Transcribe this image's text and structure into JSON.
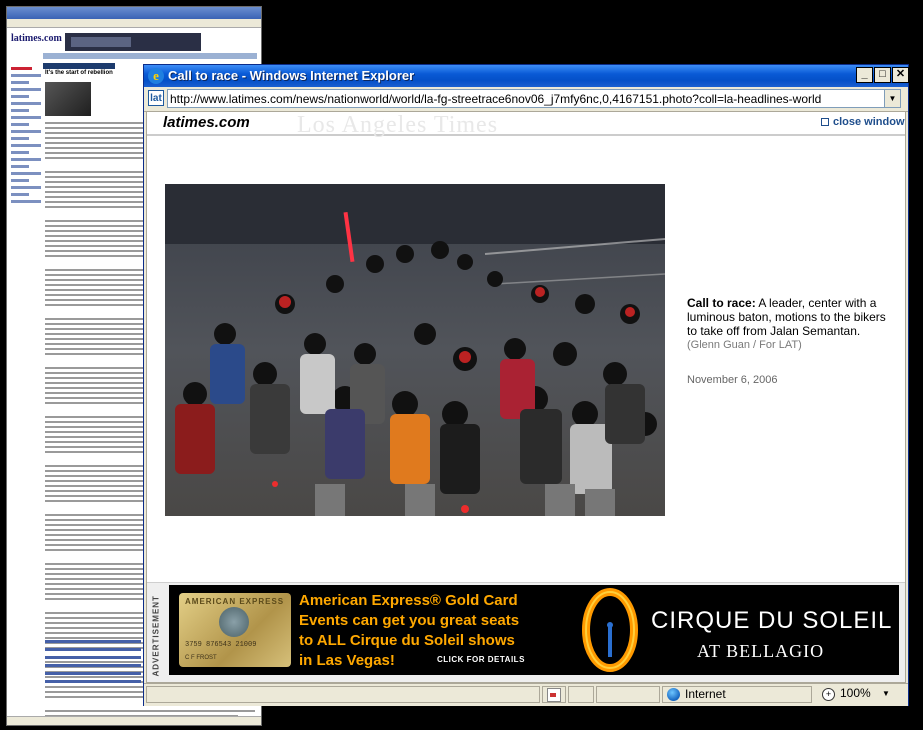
{
  "background_window": {
    "logo": "latimes.com",
    "headline": "It's the start of rebellion"
  },
  "ie": {
    "title": "Call to race - Windows Internet Explorer",
    "title_icon_glyph": "e",
    "url": "http://www.latimes.com/news/nationworld/world/la-fg-streetrace6nov06_j7mfy6nc,0,4167151.photo?coll=la-headlines-world",
    "min_glyph": "_",
    "max_glyph": "□",
    "close_glyph": "✕",
    "dropdown_glyph": "▼",
    "addr_icon_glyph": "lat"
  },
  "page": {
    "logo": "latimes.com",
    "masthead": "Los Angeles Times",
    "close_window": "close window",
    "caption_lead": "Call to race:",
    "caption_body": " A leader, center with a luminous baton, motions to the bikers to take off from Jalan Semantan.",
    "photo_credit": "(Glenn Guan / For LAT)",
    "date": "November 6, 2006"
  },
  "ad": {
    "vertical_label": "ADVERTISEMENT",
    "card_brand": "AMERICAN EXPRESS",
    "card_number": "3759 876543 21009",
    "card_name": "C F FROST",
    "line1": "American Express® Gold Card",
    "line2": "Events can get you great seats",
    "line3": "to ALL Cirque du Soleil shows",
    "line4": "in Las Vegas!",
    "cta": "CLICK FOR DETAILS",
    "cirque_title": "CIRQUE DU SOLEIL",
    "cirque_sub": "AT BELLAGIO",
    "accent": "#ffa800"
  },
  "status": {
    "text": "",
    "zone": "Internet",
    "zoom": "100%",
    "zoom_dd": "▼"
  }
}
